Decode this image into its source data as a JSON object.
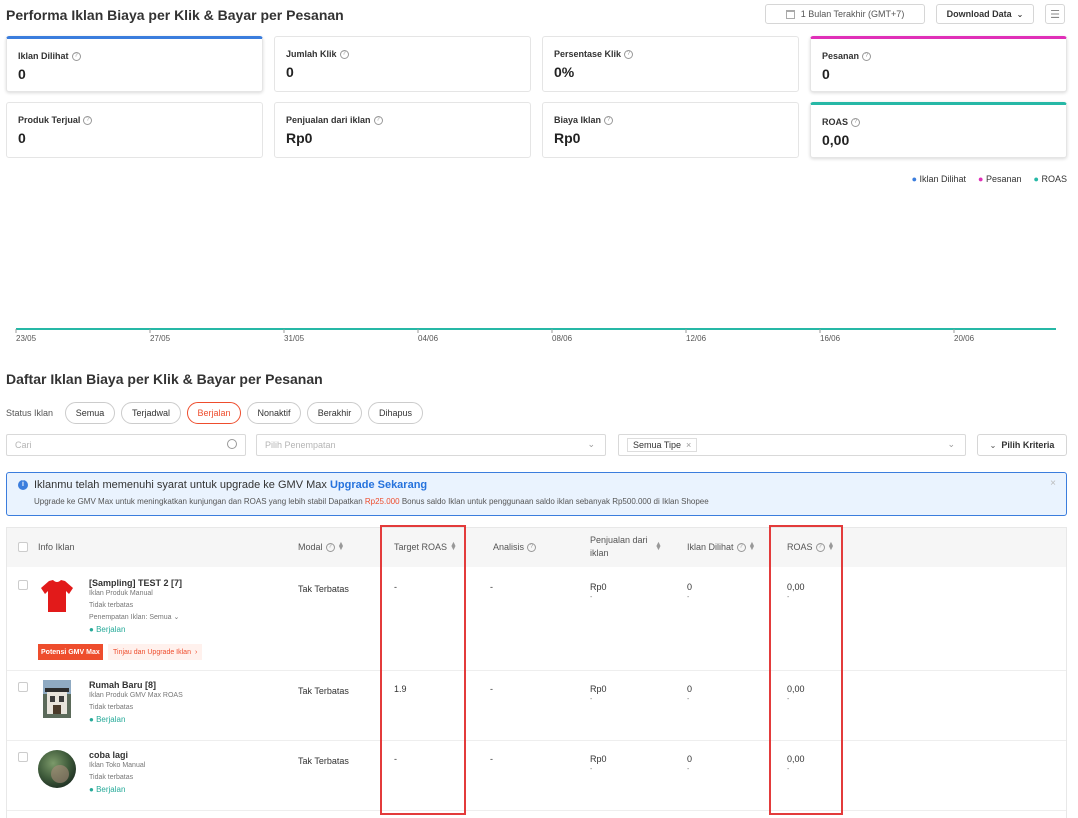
{
  "header": {
    "title": "Performa Iklan Biaya per Klik & Bayar per Pesanan",
    "date_range": "1 Bulan Terakhir (GMT+7)",
    "download_label": "Download Data"
  },
  "metrics": [
    {
      "label": "Iklan Dilihat",
      "value": "0",
      "accent": "#3b7ddd"
    },
    {
      "label": "Jumlah Klik",
      "value": "0",
      "accent": ""
    },
    {
      "label": "Persentase Klik",
      "value": "0%",
      "accent": ""
    },
    {
      "label": "Pesanan",
      "value": "0",
      "accent": "#e030b8"
    },
    {
      "label": "Produk Terjual",
      "value": "0",
      "accent": ""
    },
    {
      "label": "Penjualan dari iklan",
      "value": "Rp0",
      "accent": ""
    },
    {
      "label": "Biaya Iklan",
      "value": "Rp0",
      "accent": ""
    },
    {
      "label": "ROAS",
      "value": "0,00",
      "accent": "#26b8a6"
    }
  ],
  "chart_data": {
    "type": "line",
    "x": [
      "23/05",
      "27/05",
      "31/05",
      "04/06",
      "08/06",
      "12/06",
      "16/06",
      "20/06"
    ],
    "series": [
      {
        "name": "Iklan Dilihat",
        "color": "#3b7ddd",
        "values": [
          0,
          0,
          0,
          0,
          0,
          0,
          0,
          0
        ]
      },
      {
        "name": "Pesanan",
        "color": "#e030b8",
        "values": [
          0,
          0,
          0,
          0,
          0,
          0,
          0,
          0
        ]
      },
      {
        "name": "ROAS",
        "color": "#26b8a6",
        "values": [
          0,
          0,
          0,
          0,
          0,
          0,
          0,
          0
        ]
      }
    ],
    "legend": "top-right",
    "grid": false
  },
  "list": {
    "title": "Daftar Iklan Biaya per Klik & Bayar per Pesanan",
    "status_label": "Status Iklan",
    "status_options": [
      "Semua",
      "Terjadwal",
      "Berjalan",
      "Nonaktif",
      "Berakhir",
      "Dihapus"
    ],
    "active_status": "Berjalan",
    "search_placeholder": "Cari",
    "placement_placeholder": "Pilih Penempatan",
    "type_tag": "Semua Tipe",
    "criteria_label": "Pilih Kriteria"
  },
  "banner": {
    "title": "Iklanmu telah memenuhi syarat untuk upgrade ke GMV Max",
    "link": "Upgrade Sekarang",
    "body_before": "Upgrade ke GMV Max untuk meningkatkan kunjungan dan ROAS yang lebih stabil Dapatkan",
    "highlight": "Rp25.000",
    "body_after": "Bonus saldo Iklan untuk penggunaan saldo iklan sebanyak Rp500.000 di Iklan Shopee"
  },
  "table": {
    "headers": {
      "info": "Info Iklan",
      "modal": "Modal",
      "target_roas": "Target ROAS",
      "analisis": "Analisis",
      "penjualan": "Penjualan dari iklan",
      "dilihat": "Iklan Dilihat",
      "roas": "ROAS"
    },
    "rows": [
      {
        "name": "[Sampling] TEST 2 [7]",
        "type": "Iklan Produk Manual",
        "limit": "Tidak terbatas",
        "placement": "Penempatan Iklan: Semua",
        "status": "Berjalan",
        "modal": "Tak Terbatas",
        "target_roas": "-",
        "analisis": "-",
        "penjualan": "Rp0",
        "penjualan_sub": "-",
        "dilihat": "0",
        "dilihat_sub": "-",
        "roas": "0,00",
        "roas_sub": "-",
        "badge": "Potensi GMV Max",
        "review_link": "Tinjau dan Upgrade Iklan"
      },
      {
        "name": "Rumah Baru [8]",
        "type": "Iklan Produk GMV Max ROAS",
        "limit": "Tidak terbatas",
        "status": "Berjalan",
        "modal": "Tak Terbatas",
        "target_roas": "1.9",
        "analisis": "-",
        "penjualan": "Rp0",
        "penjualan_sub": "-",
        "dilihat": "0",
        "dilihat_sub": "-",
        "roas": "0,00",
        "roas_sub": "-"
      },
      {
        "name": "coba lagi",
        "type": "Iklan Toko Manual",
        "limit": "Tidak terbatas",
        "status": "Berjalan",
        "modal": "Tak Terbatas",
        "target_roas": "-",
        "analisis": "-",
        "penjualan": "Rp0",
        "penjualan_sub": "-",
        "dilihat": "0",
        "dilihat_sub": "-",
        "roas": "0,00",
        "roas_sub": "-"
      }
    ]
  }
}
